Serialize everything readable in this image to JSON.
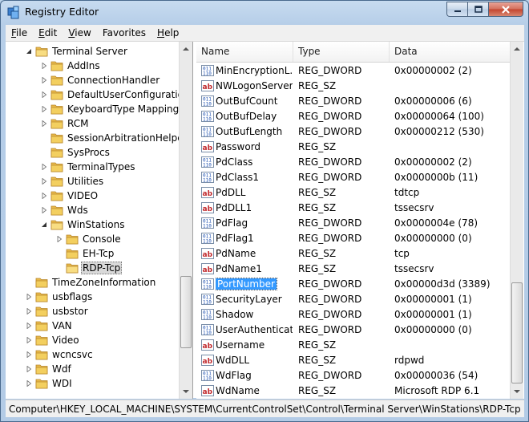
{
  "window": {
    "title": "Registry Editor"
  },
  "menu": [
    {
      "label": "File",
      "key": "F",
      "rest": "ile"
    },
    {
      "label": "Edit",
      "key": "E",
      "rest": "dit"
    },
    {
      "label": "View",
      "key": "V",
      "rest": "iew"
    },
    {
      "label": "Favorites",
      "key": "",
      "rest": "Favorites"
    },
    {
      "label": "Help",
      "key": "H",
      "rest": "elp"
    }
  ],
  "tree": [
    {
      "label": "Terminal Server",
      "level": 1,
      "state": "expanded"
    },
    {
      "label": "AddIns",
      "level": 2,
      "state": "collapsed"
    },
    {
      "label": "ConnectionHandler",
      "level": 2,
      "state": "collapsed"
    },
    {
      "label": "DefaultUserConfiguration",
      "level": 2,
      "state": "collapsed"
    },
    {
      "label": "KeyboardType Mapping",
      "level": 2,
      "state": "collapsed"
    },
    {
      "label": "RCM",
      "level": 2,
      "state": "collapsed"
    },
    {
      "label": "SessionArbitrationHelper",
      "level": 2,
      "state": "none"
    },
    {
      "label": "SysProcs",
      "level": 2,
      "state": "none"
    },
    {
      "label": "TerminalTypes",
      "level": 2,
      "state": "collapsed"
    },
    {
      "label": "Utilities",
      "level": 2,
      "state": "collapsed"
    },
    {
      "label": "VIDEO",
      "level": 2,
      "state": "collapsed"
    },
    {
      "label": "Wds",
      "level": 2,
      "state": "collapsed"
    },
    {
      "label": "WinStations",
      "level": 2,
      "state": "expanded"
    },
    {
      "label": "Console",
      "level": 3,
      "state": "collapsed"
    },
    {
      "label": "EH-Tcp",
      "level": 3,
      "state": "none"
    },
    {
      "label": "RDP-Tcp",
      "level": 3,
      "state": "none",
      "selected": true
    },
    {
      "label": "TimeZoneInformation",
      "level": 1,
      "state": "none"
    },
    {
      "label": "usbflags",
      "level": 1,
      "state": "collapsed"
    },
    {
      "label": "usbstor",
      "level": 1,
      "state": "collapsed"
    },
    {
      "label": "VAN",
      "level": 1,
      "state": "collapsed"
    },
    {
      "label": "Video",
      "level": 1,
      "state": "collapsed"
    },
    {
      "label": "wcncsvc",
      "level": 1,
      "state": "collapsed"
    },
    {
      "label": "Wdf",
      "level": 1,
      "state": "collapsed"
    },
    {
      "label": "WDI",
      "level": 1,
      "state": "collapsed"
    }
  ],
  "columns": {
    "name": "Name",
    "type": "Type",
    "data": "Data"
  },
  "values": [
    {
      "name": "MinEncryptionL...",
      "type": "REG_DWORD",
      "data": "0x00000002 (2)",
      "kind": "bin"
    },
    {
      "name": "NWLogonServer",
      "type": "REG_SZ",
      "data": "",
      "kind": "str"
    },
    {
      "name": "OutBufCount",
      "type": "REG_DWORD",
      "data": "0x00000006 (6)",
      "kind": "bin"
    },
    {
      "name": "OutBufDelay",
      "type": "REG_DWORD",
      "data": "0x00000064 (100)",
      "kind": "bin"
    },
    {
      "name": "OutBufLength",
      "type": "REG_DWORD",
      "data": "0x00000212 (530)",
      "kind": "bin"
    },
    {
      "name": "Password",
      "type": "REG_SZ",
      "data": "",
      "kind": "str"
    },
    {
      "name": "PdClass",
      "type": "REG_DWORD",
      "data": "0x00000002 (2)",
      "kind": "bin"
    },
    {
      "name": "PdClass1",
      "type": "REG_DWORD",
      "data": "0x0000000b (11)",
      "kind": "bin"
    },
    {
      "name": "PdDLL",
      "type": "REG_SZ",
      "data": "tdtcp",
      "kind": "str"
    },
    {
      "name": "PdDLL1",
      "type": "REG_SZ",
      "data": "tssecsrv",
      "kind": "str"
    },
    {
      "name": "PdFlag",
      "type": "REG_DWORD",
      "data": "0x0000004e (78)",
      "kind": "bin"
    },
    {
      "name": "PdFlag1",
      "type": "REG_DWORD",
      "data": "0x00000000 (0)",
      "kind": "bin"
    },
    {
      "name": "PdName",
      "type": "REG_SZ",
      "data": "tcp",
      "kind": "str"
    },
    {
      "name": "PdName1",
      "type": "REG_SZ",
      "data": "tssecsrv",
      "kind": "str"
    },
    {
      "name": "PortNumber",
      "type": "REG_DWORD",
      "data": "0x00000d3d (3389)",
      "kind": "bin",
      "selected": true
    },
    {
      "name": "SecurityLayer",
      "type": "REG_DWORD",
      "data": "0x00000001 (1)",
      "kind": "bin"
    },
    {
      "name": "Shadow",
      "type": "REG_DWORD",
      "data": "0x00000001 (1)",
      "kind": "bin"
    },
    {
      "name": "UserAuthenticat...",
      "type": "REG_DWORD",
      "data": "0x00000000 (0)",
      "kind": "bin"
    },
    {
      "name": "Username",
      "type": "REG_SZ",
      "data": "",
      "kind": "str"
    },
    {
      "name": "WdDLL",
      "type": "REG_SZ",
      "data": "rdpwd",
      "kind": "str"
    },
    {
      "name": "WdFlag",
      "type": "REG_DWORD",
      "data": "0x00000036 (54)",
      "kind": "bin"
    },
    {
      "name": "WdName",
      "type": "REG_SZ",
      "data": "Microsoft RDP 6.1",
      "kind": "str"
    }
  ],
  "status": {
    "path": "Computer\\HKEY_LOCAL_MACHINE\\SYSTEM\\CurrentControlSet\\Control\\Terminal Server\\WinStations\\RDP-Tcp"
  },
  "colors": {
    "selection": "#3399ff",
    "folder": "#f3cf5f",
    "title_bg": "#c7dbf0"
  }
}
